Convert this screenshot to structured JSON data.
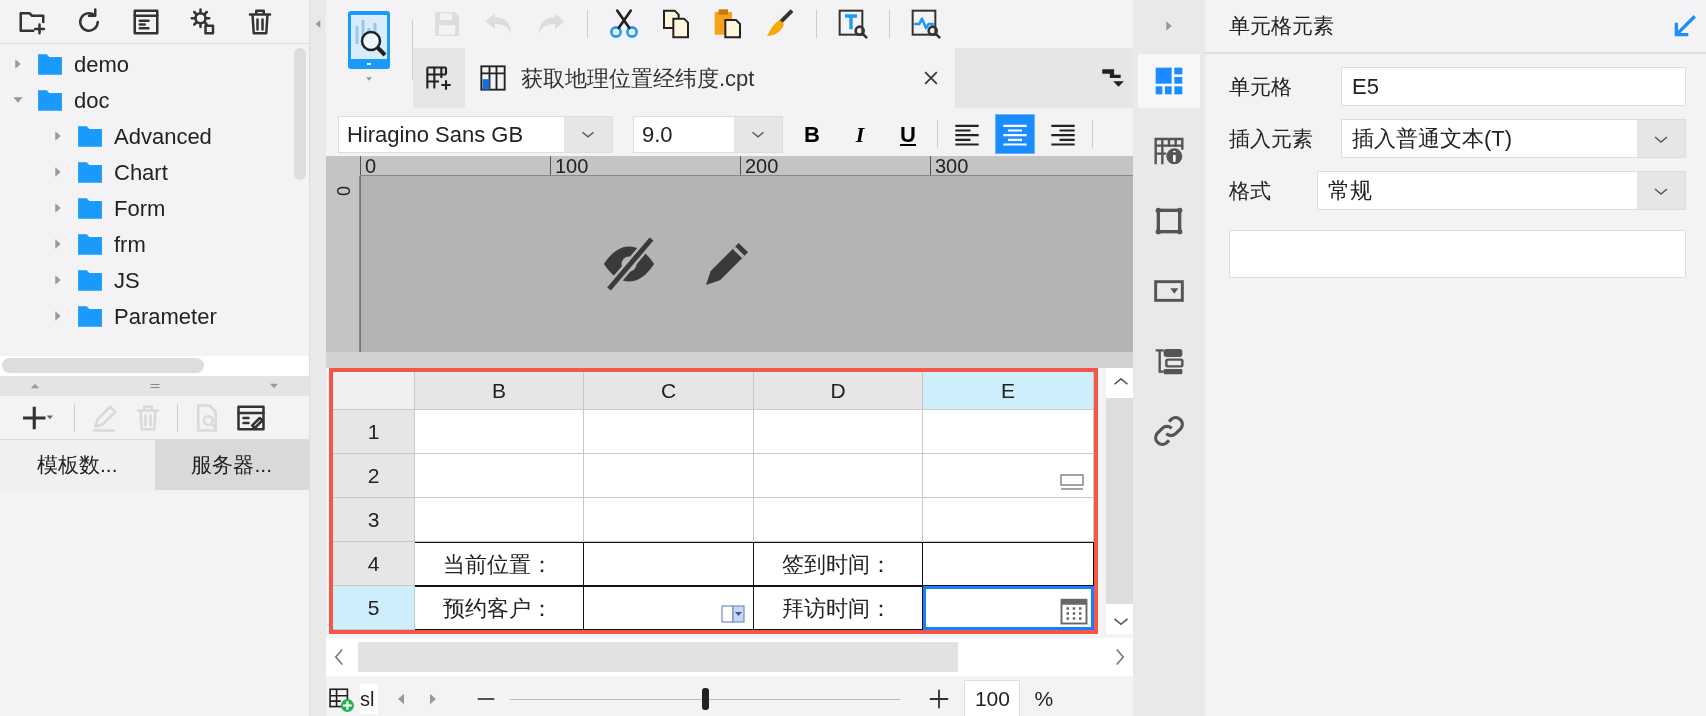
{
  "explorer": {
    "tree": [
      {
        "label": "demo",
        "expanded": false
      },
      {
        "label": "doc",
        "expanded": true,
        "children": [
          {
            "label": "Advanced",
            "expanded": false
          },
          {
            "label": "Chart",
            "expanded": false
          },
          {
            "label": "Form",
            "expanded": false
          },
          {
            "label": "frm",
            "expanded": false
          },
          {
            "label": "JS",
            "expanded": false
          },
          {
            "label": "Parameter",
            "expanded": false
          }
        ]
      }
    ]
  },
  "dataset_actions": [
    {
      "kind": "add",
      "disabled": false
    },
    {
      "kind": "edit",
      "disabled": true
    },
    {
      "kind": "delete",
      "disabled": true
    },
    {
      "kind": "preview",
      "disabled": true
    },
    {
      "kind": "server",
      "disabled": false
    }
  ],
  "dataset_tabs": [
    {
      "label": "模板数...",
      "selected": true
    },
    {
      "label": "服务器...",
      "selected": false
    }
  ],
  "toolbar": [
    {
      "kind": "save",
      "disabled": true
    },
    {
      "kind": "undo",
      "disabled": true
    },
    {
      "kind": "redo",
      "disabled": true
    },
    {
      "kind": "cut",
      "disabled": false
    },
    {
      "kind": "copy",
      "disabled": false
    },
    {
      "kind": "paste",
      "disabled": false
    },
    {
      "kind": "brush",
      "disabled": false
    },
    {
      "kind": "text-search",
      "disabled": false
    },
    {
      "kind": "chart-search",
      "disabled": false
    }
  ],
  "file_tabs": [
    {
      "label": "获取地理位置经纬度.cpt",
      "selected": true
    }
  ],
  "format_bar": {
    "font": "Hiragino Sans GB",
    "size": "9.0",
    "styles": [
      {
        "label": "B",
        "kind": "bold",
        "selected": false
      },
      {
        "label": "I",
        "kind": "italic",
        "selected": false
      },
      {
        "label": "U",
        "kind": "underline",
        "selected": false
      }
    ],
    "align": [
      {
        "kind": "left",
        "selected": false
      },
      {
        "kind": "center",
        "selected": true
      },
      {
        "kind": "right",
        "selected": false
      }
    ]
  },
  "ruler": {
    "ticks": [
      "0",
      "100",
      "200",
      "300"
    ],
    "vertical": "0"
  },
  "sheet": {
    "columns": [
      {
        "label": "B",
        "selected": false
      },
      {
        "label": "C",
        "selected": false
      },
      {
        "label": "D",
        "selected": false
      },
      {
        "label": "E",
        "selected": true
      }
    ],
    "rows": [
      {
        "label": "1",
        "selected": false,
        "bordered": false,
        "cells": [
          {
            "kind": "plain",
            "selected": false
          },
          {
            "kind": "plain",
            "selected": false
          },
          {
            "kind": "plain",
            "selected": false
          },
          {
            "kind": "plain",
            "selected": false
          }
        ]
      },
      {
        "label": "2",
        "selected": false,
        "bordered": false,
        "cells": [
          {
            "kind": "plain",
            "selected": false
          },
          {
            "kind": "plain",
            "selected": false
          },
          {
            "kind": "plain",
            "selected": false
          },
          {
            "kind": "textbox",
            "selected": false
          }
        ]
      },
      {
        "label": "3",
        "selected": false,
        "bordered": false,
        "cells": [
          {
            "kind": "plain",
            "selected": false
          },
          {
            "kind": "plain",
            "selected": false
          },
          {
            "kind": "plain",
            "selected": false
          },
          {
            "kind": "plain",
            "selected": false
          }
        ]
      },
      {
        "label": "4",
        "selected": false,
        "bordered": true,
        "cells": [
          {
            "kind": "text",
            "selected": false,
            "text": "当前位置："
          },
          {
            "kind": "plain",
            "selected": false
          },
          {
            "kind": "text",
            "selected": false,
            "text": "签到时间："
          },
          {
            "kind": "plain",
            "selected": false
          }
        ]
      },
      {
        "label": "5",
        "selected": true,
        "bordered": true,
        "cells": [
          {
            "kind": "text",
            "selected": false,
            "text": "预约客户："
          },
          {
            "kind": "dropdown",
            "selected": false
          },
          {
            "kind": "text",
            "selected": false,
            "text": "拜访时间："
          },
          {
            "kind": "date",
            "selected": true
          }
        ]
      }
    ]
  },
  "sheet_tab": {
    "label": "sl"
  },
  "zoom": {
    "level": 0.5,
    "value": "100",
    "unit": "%"
  },
  "side_tabs": [
    {
      "kind": "cell-element",
      "selected": true
    },
    {
      "kind": "cell-attr",
      "selected": false
    },
    {
      "kind": "border",
      "selected": false
    },
    {
      "kind": "widget",
      "selected": false
    },
    {
      "kind": "condition",
      "selected": false
    },
    {
      "kind": "link",
      "selected": false
    }
  ],
  "panel": {
    "title": "单元格元素",
    "fields": [
      {
        "label": "单元格",
        "kind": "text",
        "value": "E5"
      },
      {
        "label": "插入元素",
        "kind": "select",
        "value": "插入普通文本(T)"
      },
      {
        "label": "格式",
        "kind": "select",
        "value": "常规"
      }
    ]
  }
}
